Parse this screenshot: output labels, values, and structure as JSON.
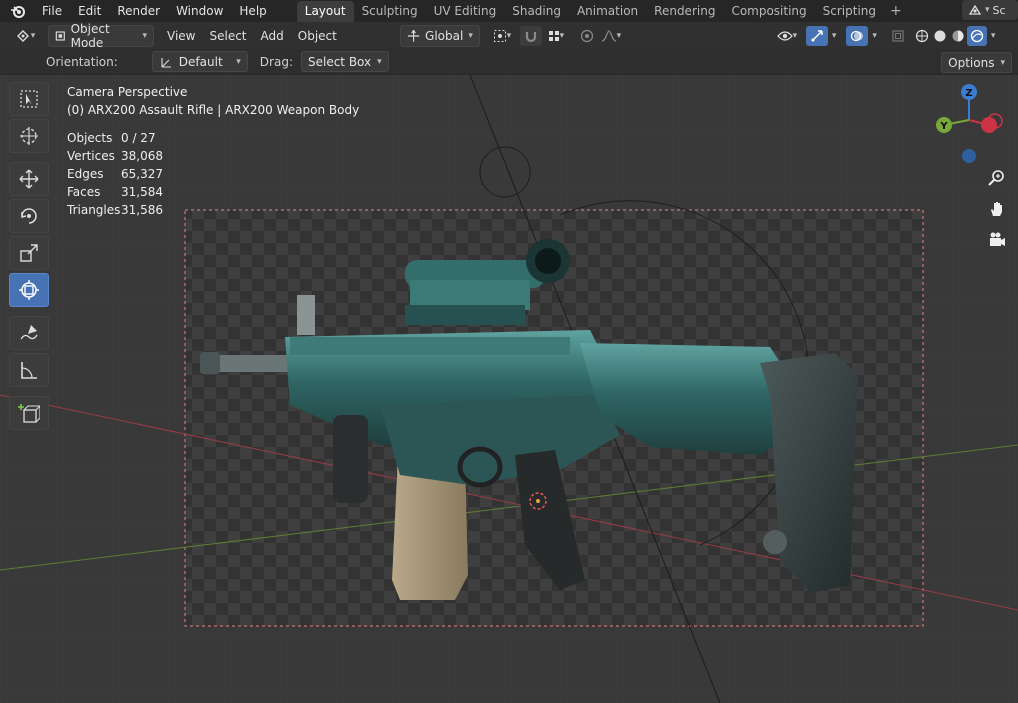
{
  "menubar": {
    "items": [
      "File",
      "Edit",
      "Render",
      "Window",
      "Help"
    ],
    "tabs": [
      "Layout",
      "Sculpting",
      "UV Editing",
      "Shading",
      "Animation",
      "Rendering",
      "Compositing",
      "Scripting"
    ],
    "active_tab": "Layout",
    "add_tab": "+",
    "scene_label": "Sc"
  },
  "header": {
    "mode": "Object Mode",
    "menus": [
      "View",
      "Select",
      "Add",
      "Object"
    ],
    "transform_orientation": "Global"
  },
  "toolsettings": {
    "orientation_label": "Orientation:",
    "orientation_value": "Default",
    "drag_label": "Drag:",
    "drag_value": "Select Box",
    "options_label": "Options"
  },
  "viewport": {
    "view_name": "Camera Perspective",
    "active_object": "(0) ARX200 Assault Rifle | ARX200 Weapon Body",
    "stats": [
      {
        "key": "Objects",
        "value": "0 / 27"
      },
      {
        "key": "Vertices",
        "value": "38,068"
      },
      {
        "key": "Edges",
        "value": "65,327"
      },
      {
        "key": "Faces",
        "value": "31,584"
      },
      {
        "key": "Triangles",
        "value": "31,586"
      }
    ],
    "gizmo_axes": {
      "z": "Z",
      "y": "Y",
      "x": ""
    }
  },
  "colors": {
    "accent_active": "#4772b3",
    "x_axis": "#cc3344",
    "y_axis": "#78a83a",
    "z_axis": "#3b7cd3"
  },
  "icons": {
    "toolbar": [
      "select-box-icon",
      "cursor-icon",
      "move-icon",
      "rotate-icon",
      "scale-icon",
      "transform-icon",
      "annotate-icon",
      "measure-icon",
      "add-cube-icon"
    ],
    "nav": [
      "zoom-icon",
      "hand-pan-icon",
      "camera-view-icon"
    ]
  }
}
